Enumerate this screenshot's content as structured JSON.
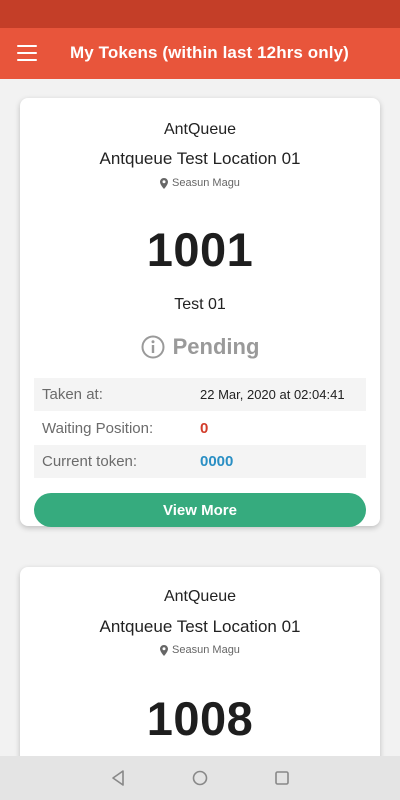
{
  "app_bar": {
    "title": "My Tokens (within last 12hrs only)",
    "menu_icon": "hamburger-menu-icon",
    "background": "#e8553b",
    "status_bar_color": "#c43e28"
  },
  "tokens": [
    {
      "company": "AntQueue",
      "location": "Antqueue Test Location 01",
      "place": "Seasun Magu",
      "token_number": "1001",
      "name": "Test 01",
      "status": "Pending",
      "status_icon": "info-icon",
      "rows": [
        {
          "label": "Taken at:",
          "value": "22 Mar, 2020 at 02:04:41"
        },
        {
          "label": "Waiting Position:",
          "value": "0"
        },
        {
          "label": "Current token:",
          "value": "0000"
        }
      ],
      "button_label": "View More"
    },
    {
      "company": "AntQueue",
      "location": "Antqueue Test Location 01",
      "place": "Seasun Magu",
      "token_number": "1008"
    }
  ],
  "colors": {
    "button": "#36ab7e",
    "waiting_position": "#d23c2a",
    "current_token": "#2a8fc4",
    "status": "#9a9a9a"
  },
  "nav": {
    "back_icon": "back-triangle-icon",
    "home_icon": "home-circle-icon",
    "recent_icon": "recent-apps-square-icon"
  }
}
